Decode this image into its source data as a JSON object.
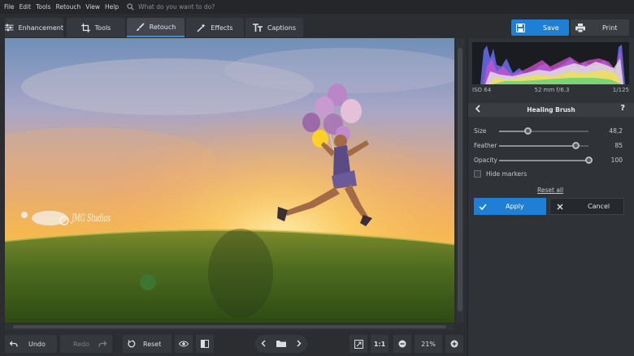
{
  "menu": {
    "items": [
      "File",
      "Edit",
      "Tools",
      "Retouch",
      "View",
      "Help"
    ],
    "search_placeholder": "What do you want to do?"
  },
  "tabs": [
    {
      "label": "Enhancement",
      "icon": "sliders-icon"
    },
    {
      "label": "Tools",
      "icon": "crop-icon"
    },
    {
      "label": "Retouch",
      "icon": "brush-icon",
      "active": true
    },
    {
      "label": "Effects",
      "icon": "magic-wand-icon"
    },
    {
      "label": "Captions",
      "icon": "text-icon"
    }
  ],
  "actions": {
    "save_label": "Save",
    "print_label": "Print"
  },
  "canvas": {
    "watermark": "JMG Studios"
  },
  "exif": {
    "iso": "ISO 64",
    "lens": "52 mm f/6.3",
    "shutter": "1/125"
  },
  "healing_brush": {
    "title": "Healing Brush",
    "help": "?",
    "sliders": [
      {
        "label": "Size",
        "value_text": "48,2",
        "fraction": 0.32
      },
      {
        "label": "Feather",
        "value_text": "85",
        "fraction": 0.85
      },
      {
        "label": "Opacity",
        "value_text": "100",
        "fraction": 1.0
      }
    ],
    "hide_markers_label": "Hide markers",
    "hide_markers_checked": false,
    "reset_all_label": "Reset all",
    "apply_label": "Apply",
    "cancel_label": "Cancel"
  },
  "bottom": {
    "undo_label": "Undo",
    "redo_label": "Redo",
    "reset_label": "Reset",
    "actual_size_label": "1:1",
    "zoom_value": "21%"
  },
  "colors": {
    "accent": "#1f7fd4",
    "panel": "#2f3236",
    "background": "#2b2d31"
  }
}
